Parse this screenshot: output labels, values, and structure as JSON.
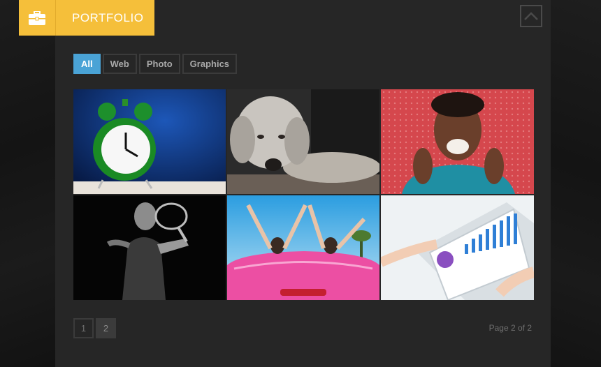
{
  "header": {
    "title": "PORTFOLIO"
  },
  "filters": [
    {
      "label": "All",
      "active": true
    },
    {
      "label": "Web",
      "active": false
    },
    {
      "label": "Photo",
      "active": false
    },
    {
      "label": "Graphics",
      "active": false
    }
  ],
  "gallery": [
    {
      "icon": "alarm-clock-photo"
    },
    {
      "icon": "dog-photo"
    },
    {
      "icon": "excited-woman-photo"
    },
    {
      "icon": "tennis-player-photo"
    },
    {
      "icon": "convertible-car-photo"
    },
    {
      "icon": "tablet-chart-photo"
    }
  ],
  "pagination": {
    "pages": [
      "1",
      "2"
    ],
    "current": "2",
    "status": "Page 2 of 2"
  },
  "colors": {
    "accent": "#f5bf3a",
    "active_filter": "#4aa3d6",
    "panel": "#262626"
  },
  "icons": {
    "badge": "briefcase-icon",
    "scroll_top": "chevron-up-icon"
  }
}
